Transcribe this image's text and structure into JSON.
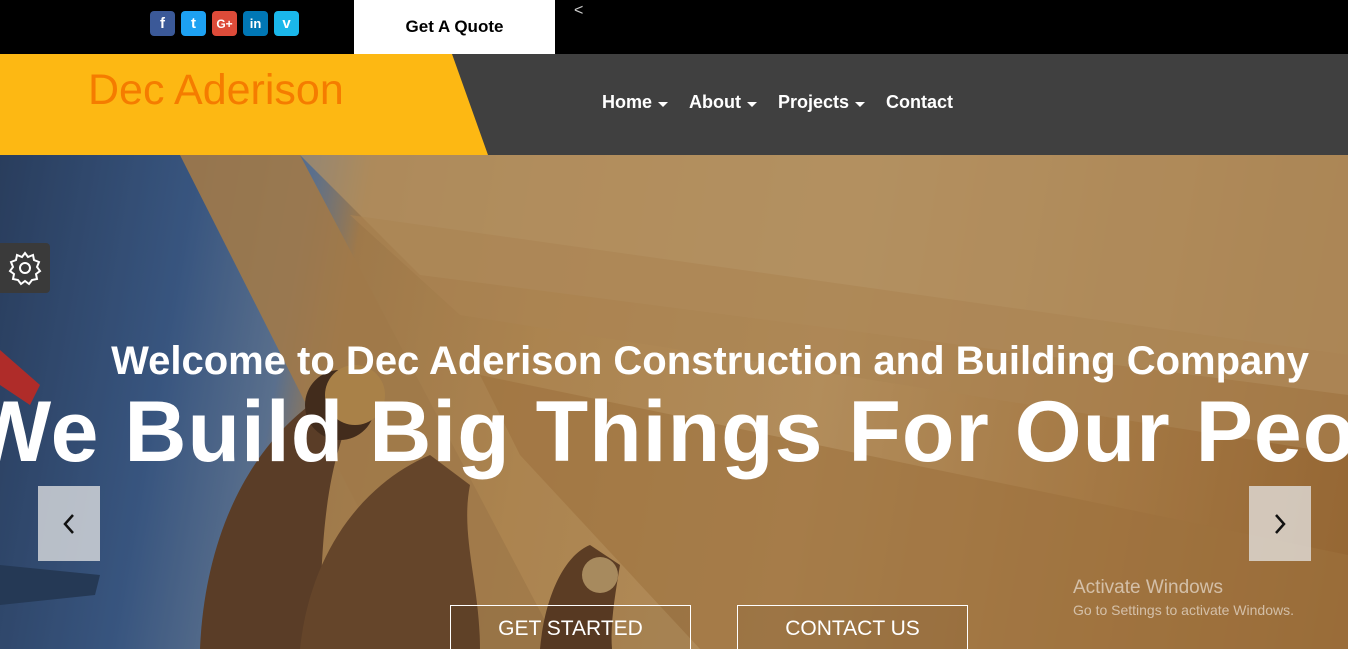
{
  "topbar": {
    "social": [
      {
        "name": "facebook",
        "glyph": "f",
        "color": "#3b5998"
      },
      {
        "name": "twitter",
        "glyph": "t",
        "color": "#1da1f2"
      },
      {
        "name": "google-plus",
        "glyph": "G+",
        "color": "#dd4b39"
      },
      {
        "name": "linkedin",
        "glyph": "in",
        "color": "#0077b5"
      },
      {
        "name": "vimeo",
        "glyph": "v",
        "color": "#1ab7ea"
      }
    ],
    "quote_label": "Get A Quote",
    "back_glyph": "<"
  },
  "header": {
    "logo": "Dec Aderison",
    "logo_bg_color": "#fdb813",
    "nav": [
      {
        "label": "Home",
        "dropdown": true
      },
      {
        "label": "About",
        "dropdown": true
      },
      {
        "label": "Projects",
        "dropdown": true
      },
      {
        "label": "Contact",
        "dropdown": false
      }
    ]
  },
  "hero": {
    "welcome": "Welcome to Dec Aderison Construction and Building Company",
    "headline": "We Build Big Things For Our People",
    "cta_primary": "GET STARTED",
    "cta_secondary": "CONTACT US"
  },
  "watermark": {
    "title": "Activate Windows",
    "subtitle": "Go to Settings to activate Windows."
  }
}
